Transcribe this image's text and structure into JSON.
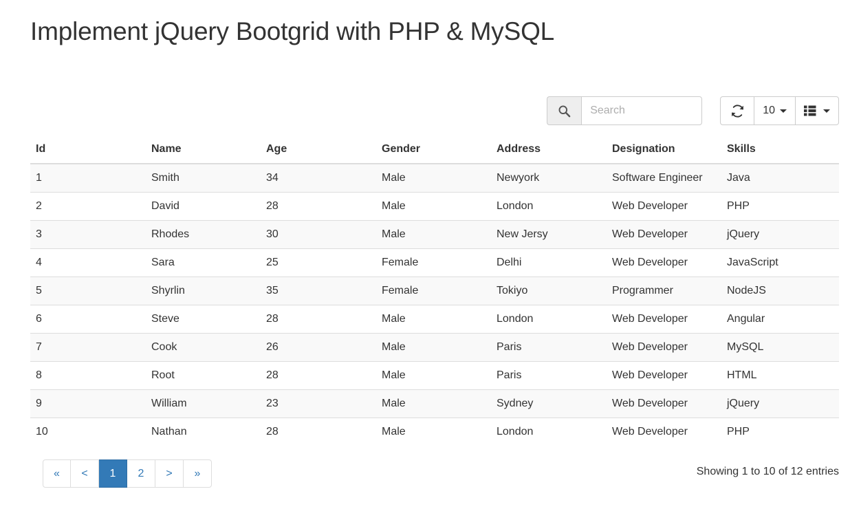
{
  "page": {
    "title": "Implement jQuery Bootgrid with PHP & MySQL"
  },
  "toolbar": {
    "search": {
      "icon": "search-icon",
      "value": "",
      "placeholder": "Search"
    },
    "refresh": {
      "icon": "refresh-icon",
      "label": ""
    },
    "rowcount": {
      "label": "10",
      "caret": "caret-down-icon"
    },
    "columns": {
      "icon": "column-list-icon",
      "label": "",
      "caret": "caret-down-icon"
    }
  },
  "table": {
    "columns": [
      {
        "key": "id",
        "label": "Id"
      },
      {
        "key": "name",
        "label": "Name"
      },
      {
        "key": "age",
        "label": "Age"
      },
      {
        "key": "gender",
        "label": "Gender"
      },
      {
        "key": "address",
        "label": "Address"
      },
      {
        "key": "designation",
        "label": "Designation"
      },
      {
        "key": "skills",
        "label": "Skills"
      }
    ],
    "rows": [
      {
        "id": "1",
        "name": "Smith",
        "age": "34",
        "gender": "Male",
        "address": "Newyork",
        "designation": "Software Engineer",
        "skills": "Java"
      },
      {
        "id": "2",
        "name": "David",
        "age": "28",
        "gender": "Male",
        "address": "London",
        "designation": "Web Developer",
        "skills": "PHP"
      },
      {
        "id": "3",
        "name": "Rhodes",
        "age": "30",
        "gender": "Male",
        "address": "New Jersy",
        "designation": "Web Developer",
        "skills": "jQuery"
      },
      {
        "id": "4",
        "name": "Sara",
        "age": "25",
        "gender": "Female",
        "address": "Delhi",
        "designation": "Web Developer",
        "skills": "JavaScript"
      },
      {
        "id": "5",
        "name": "Shyrlin",
        "age": "35",
        "gender": "Female",
        "address": "Tokiyo",
        "designation": "Programmer",
        "skills": "NodeJS"
      },
      {
        "id": "6",
        "name": "Steve",
        "age": "28",
        "gender": "Male",
        "address": "London",
        "designation": "Web Developer",
        "skills": "Angular"
      },
      {
        "id": "7",
        "name": "Cook",
        "age": "26",
        "gender": "Male",
        "address": "Paris",
        "designation": "Web Developer",
        "skills": "MySQL"
      },
      {
        "id": "8",
        "name": "Root",
        "age": "28",
        "gender": "Male",
        "address": "Paris",
        "designation": "Web Developer",
        "skills": "HTML"
      },
      {
        "id": "9",
        "name": "William",
        "age": "23",
        "gender": "Male",
        "address": "Sydney",
        "designation": "Web Developer",
        "skills": "jQuery"
      },
      {
        "id": "10",
        "name": "Nathan",
        "age": "28",
        "gender": "Male",
        "address": "London",
        "designation": "Web Developer",
        "skills": "PHP"
      }
    ]
  },
  "footer": {
    "pagination": [
      {
        "label": "«",
        "name": "first",
        "active": false
      },
      {
        "label": "<",
        "name": "prev",
        "active": false
      },
      {
        "label": "1",
        "name": "page-1",
        "active": true
      },
      {
        "label": "2",
        "name": "page-2",
        "active": false
      },
      {
        "label": ">",
        "name": "next",
        "active": false
      },
      {
        "label": "»",
        "name": "last",
        "active": false
      }
    ],
    "info": "Showing 1 to 10 of 12 entries"
  },
  "colors": {
    "accent": "#337ab7",
    "accent_border": "#2e6da4",
    "stripe": "#f9f9f9",
    "border": "#dddddd",
    "addon_bg": "#eeeeee",
    "input_border": "#cccccc",
    "text": "#333333",
    "placeholder": "#adadad"
  }
}
